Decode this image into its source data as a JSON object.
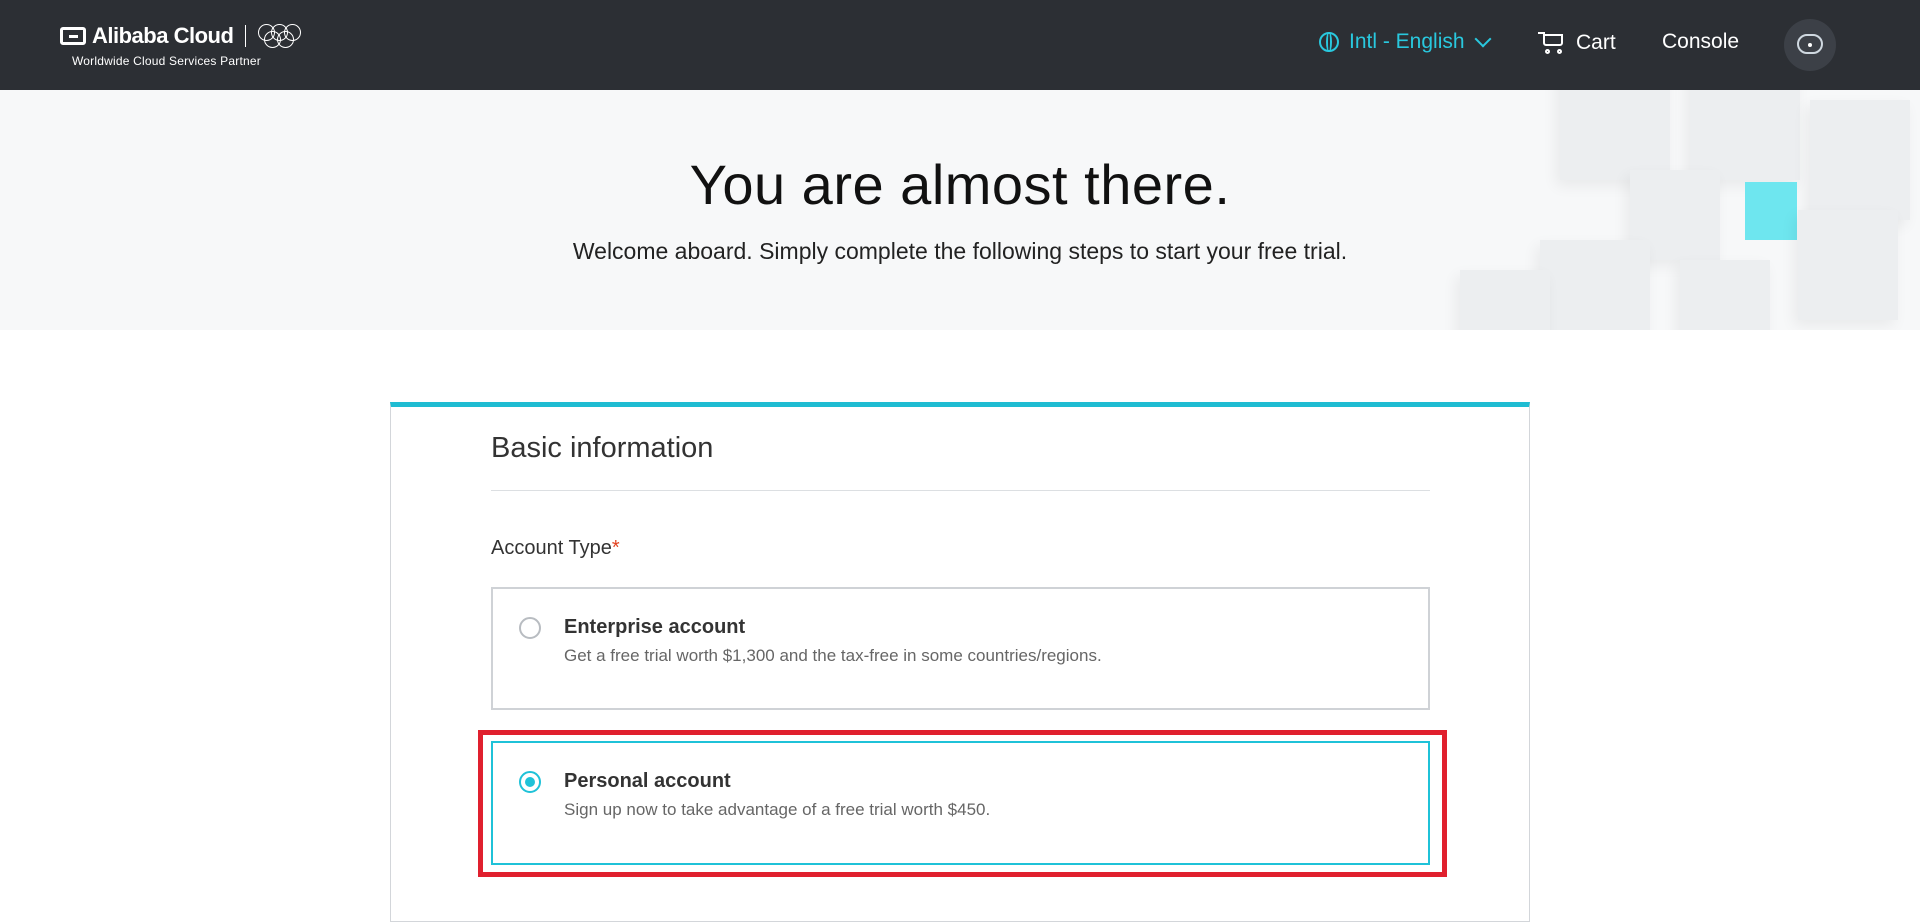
{
  "header": {
    "brand": "Alibaba Cloud",
    "tagline": "Worldwide Cloud Services Partner",
    "language": "Intl - English",
    "cart": "Cart",
    "console": "Console",
    "icons": [
      "alibaba-logo-icon",
      "olympic-rings-icon",
      "globe-icon",
      "chevron-down-icon",
      "cart-icon",
      "user-avatar-icon"
    ]
  },
  "hero": {
    "title": "You are almost there.",
    "subtitle": "Welcome aboard. Simply complete the following steps to start your free trial."
  },
  "form": {
    "section_title": "Basic information",
    "account_type_label": "Account Type",
    "required_mark": "*",
    "options": [
      {
        "title": "Enterprise account",
        "description": "Get a free trial worth $1,300 and the tax-free in some countries/regions.",
        "selected": false
      },
      {
        "title": "Personal account",
        "description": "Sign up now to take advantage of a free trial worth $450.",
        "selected": true
      }
    ]
  },
  "colors": {
    "topbar": "#2c2f34",
    "accent": "#1fc2d8",
    "highlight": "#e0202e",
    "required": "#e2411f"
  }
}
